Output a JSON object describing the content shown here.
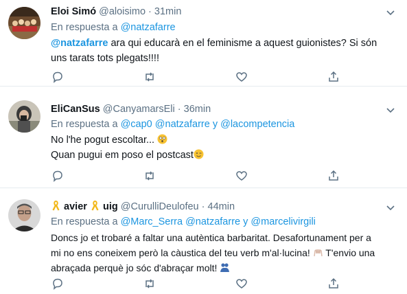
{
  "tweets": [
    {
      "name": "Eloi Simó",
      "handle": "@aloisimo",
      "dot": "·",
      "time": "31min",
      "reply_prefix": "En respuesta a",
      "reply_to_1": "@natzafarre",
      "mention": "@natzafarre",
      "line1": " ara qui educarà en el feminisme a aquest guionistes? Si són",
      "line2": "uns tarats tots plegats!!!!"
    },
    {
      "name": "EliCanSus",
      "handle": "@CanyamarsEli",
      "dot": "·",
      "time": "36min",
      "reply_prefix": "En respuesta a",
      "reply_to_1": "@cap0",
      "reply_to_2": "@natzafarre",
      "reply_joiner": "y",
      "reply_to_3": "@lacompetencia",
      "line1": "No l'he pogut escoltar...",
      "line2": "Quan pugui em poso el postcast"
    },
    {
      "name_part1": "avier",
      "name_part2": "uig",
      "handle": "@CurulliDeulofeu",
      "dot": "·",
      "time": "44min",
      "reply_prefix": "En respuesta a",
      "reply_to_1": "@Marc_Serra",
      "reply_to_2": "@natzafarre",
      "reply_joiner": "y",
      "reply_to_3": "@marcelivirgili",
      "line1": "Doncs jo et trobaré a faltar una autèntica barbaritat. Desafortunament per a",
      "line2a": "mi no ens coneixem però la càustica del teu verb m'al·lucina!",
      "line2b": "T'envio una",
      "line3": "abraçada perquè jo sóc d'abraçar molt!"
    }
  ],
  "icons": {
    "reply": "reply-icon",
    "retweet": "retweet-icon",
    "like": "like-icon",
    "share": "share-icon",
    "more": "chevron-down-icon"
  },
  "colors": {
    "link": "#1b95e0",
    "secondary": "#5b7083",
    "divider": "#e6ecf0"
  }
}
